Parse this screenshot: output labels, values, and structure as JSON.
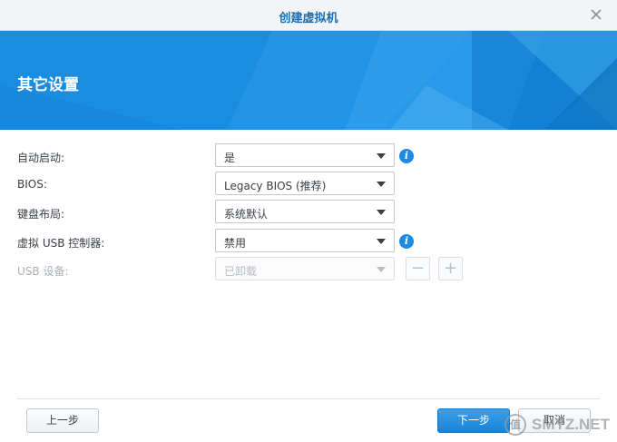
{
  "window": {
    "title": "创建虚拟机"
  },
  "banner": {
    "heading": "其它设置"
  },
  "form": {
    "rows": [
      {
        "label": "自动启动:",
        "value": "是",
        "has_info": true,
        "enabled": true
      },
      {
        "label": "BIOS:",
        "value": "Legacy BIOS (推荐)",
        "has_info": false,
        "enabled": true
      },
      {
        "label": "键盘布局:",
        "value": "系统默认",
        "has_info": false,
        "enabled": true
      },
      {
        "label": "虚拟 USB 控制器:",
        "value": "禁用",
        "has_info": true,
        "enabled": true
      },
      {
        "label": "USB 设备:",
        "value": "已卸载",
        "has_info": false,
        "enabled": false
      }
    ],
    "stepper": {
      "minus": "−",
      "plus": "+"
    }
  },
  "footer": {
    "prev_label": "上一步",
    "next_label": "下一步",
    "cancel_label": "取消"
  },
  "watermark": {
    "text": "SMYZ.NET",
    "badge": "值"
  },
  "colors": {
    "accent": "#1a8de0",
    "title_text": "#1c6fb5",
    "info_icon": "#1e8ae4"
  },
  "icons": {
    "close": "close-icon",
    "info": "info-icon",
    "dropdown": "chevron-down-icon"
  }
}
